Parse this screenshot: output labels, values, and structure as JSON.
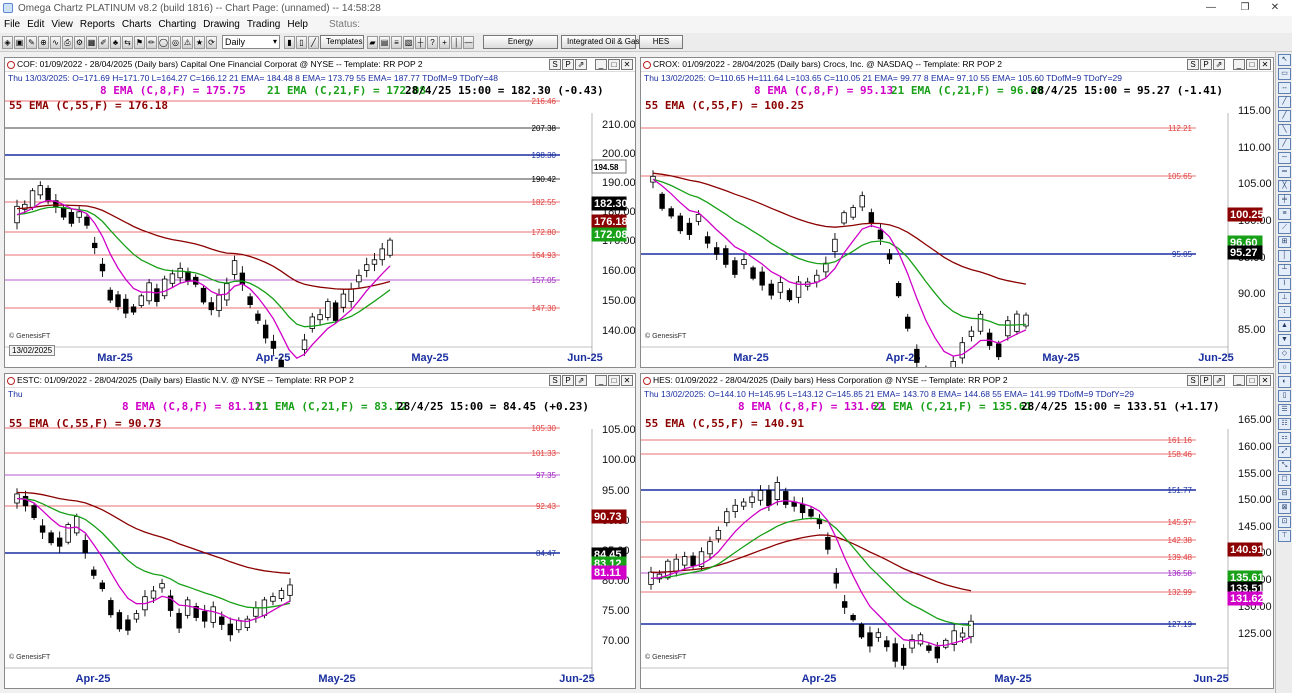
{
  "app": {
    "title": "Omega Chartz PLATINUM v8.2 (build 1816)  -- Chart Page: (unnamed) -- 14:58:28",
    "window_controls": [
      "—",
      "❐",
      "✕"
    ]
  },
  "menu": {
    "items": [
      "File",
      "Edit",
      "View",
      "Reports",
      "Charts",
      "Charting",
      "Drawing",
      "Trading",
      "Help"
    ],
    "status_label": "Status:"
  },
  "toolbar": {
    "period_select": "Daily",
    "templates_label": "Templates",
    "buttons": [
      "Energy",
      "Integrated Oil & Gas",
      "HES"
    ]
  },
  "colors": {
    "ema8": "#d000c8",
    "ema21": "#18a018",
    "ema55": "#8b0000",
    "hline_red": "#e04040",
    "hline_blue": "#1a2fa0"
  },
  "panels": [
    {
      "id": "cof",
      "header": "COF: 01/09/2022 - 28/04/2025  (Daily bars)  Capital One Financial Corporat @ NYSE  --  Template: RR POP 2",
      "info": "Thu   13/03/2025:  O=171.69  H=171.70  L=164.27  C=166.12  21 EMA= 184.48  8 EMA= 173.79  55 EMA= 187.77  TDofM=9  TDofY=48",
      "ema8": "8 EMA (C,8,F) = 175.75",
      "ema21": "21 EMA (C,21,F) = 172.08",
      "last": "28/4/25 15:00 = 182.30 (-0.43)",
      "ema55": "55 EMA (C,55,F) = 176.18",
      "y_ticks": [
        "210.00",
        "200.00",
        "190.00",
        "180.00",
        "170.00",
        "160.00",
        "150.00",
        "140.00"
      ],
      "hlines": [
        "216.46",
        "207.38",
        "198.30",
        "190.42",
        "182.55",
        "172.80",
        "164.93",
        "157.05",
        "147.30"
      ],
      "value_tags": [
        "194.58",
        "182.30",
        "176.18",
        "172.08"
      ],
      "x_ticks": [
        "Mar-25",
        "Apr-25",
        "May-25",
        "Jun-25"
      ],
      "date_box": "13/02/2025",
      "footer": "© GenesisFT",
      "ctrl": [
        "S",
        "P",
        "⇗",
        "_",
        "□",
        "✕"
      ]
    },
    {
      "id": "crox",
      "header": "CROX: 01/09/2022 - 28/04/2025  (Daily bars)  Crocs, Inc. @ NASDAQ  --  Template: RR POP 2",
      "info": "Thu   13/02/2025:  O=110.65  H=111.64  L=103.65  C=110.05  21 EMA= 99.77  8 EMA= 97.10  55 EMA= 105.60  TDofM=9  TDofY=29",
      "ema8": "8 EMA (C,8,F) = 95.13",
      "ema21": "21 EMA (C,21,F) = 96.60",
      "last": "28/4/25 15:00 = 95.27 (-1.41)",
      "ema55": "55 EMA (C,55,F) = 100.25",
      "y_ticks": [
        "115.00",
        "110.00",
        "105.00",
        "100.00",
        "95.00",
        "90.00",
        "85.00"
      ],
      "hlines": [
        "112.21",
        "105.65",
        "95.05"
      ],
      "value_tags": [
        "100.25",
        "96.60",
        "95.27"
      ],
      "x_ticks": [
        "Mar-25",
        "Apr-25",
        "May-25",
        "Jun-25"
      ],
      "footer": "© GenesisFT",
      "ctrl": [
        "S",
        "P",
        "⇗",
        "_",
        "□",
        "✕"
      ]
    },
    {
      "id": "estc",
      "header": "ESTC: 01/09/2022 - 28/04/2025  (Daily bars)  Elastic N.V. @ NYSE  --  Template: RR POP 2",
      "info": "Thu",
      "ema8": "8 EMA (C,8,F) = 81.11",
      "ema21": "21 EMA (C,21,F) = 83.12",
      "last": "28/4/25 15:00 = 84.45 (+0.23)",
      "ema55": "55 EMA (C,55,F) = 90.73",
      "y_ticks": [
        "105.00",
        "100.00",
        "95.00",
        "90.00",
        "85.00",
        "80.00",
        "75.00",
        "70.00"
      ],
      "hlines": [
        "105.30",
        "101.33",
        "97.35",
        "92.43",
        "84.47"
      ],
      "value_tags": [
        "90.73",
        "84.45",
        "83.12",
        "81.11"
      ],
      "x_ticks": [
        "Apr-25",
        "May-25",
        "Jun-25"
      ],
      "footer": "© GenesisFT",
      "ctrl": [
        "S",
        "P",
        "⇗",
        "_",
        "□",
        "✕"
      ]
    },
    {
      "id": "hes",
      "header": "HES: 01/09/2022 - 28/04/2025  (Daily bars)  Hess Corporation @ NYSE  --  Template: RR POP 2",
      "info": "Thu   13/02/2025:  O=144.10  H=145.95  L=143.12  C=145.85  21 EMA= 143.70  8 EMA= 144.68  55 EMA= 141.99  TDofM=9  TDofY=29",
      "ema8": "8 EMA (C,8,F) = 131.62",
      "ema21": "21 EMA (C,21,F) = 135.61",
      "last": "28/4/25 15:00 = 133.51 (+1.17)",
      "ema55": "55 EMA (C,55,F) = 140.91",
      "y_ticks": [
        "165.00",
        "160.00",
        "155.00",
        "150.00",
        "145.00",
        "140.00",
        "135.00",
        "130.00",
        "125.00"
      ],
      "hlines": [
        "161.16",
        "158.46",
        "151.77",
        "145.97",
        "142.38",
        "139.48",
        "136.58",
        "132.99",
        "127.19"
      ],
      "value_tags": [
        "140.91",
        "135.61",
        "133.51",
        "131.62"
      ],
      "x_ticks": [
        "Apr-25",
        "May-25",
        "Jun-25"
      ],
      "footer": "© GenesisFT",
      "ctrl": [
        "S",
        "P",
        "⇗",
        "_",
        "□",
        "✕"
      ]
    }
  ]
}
